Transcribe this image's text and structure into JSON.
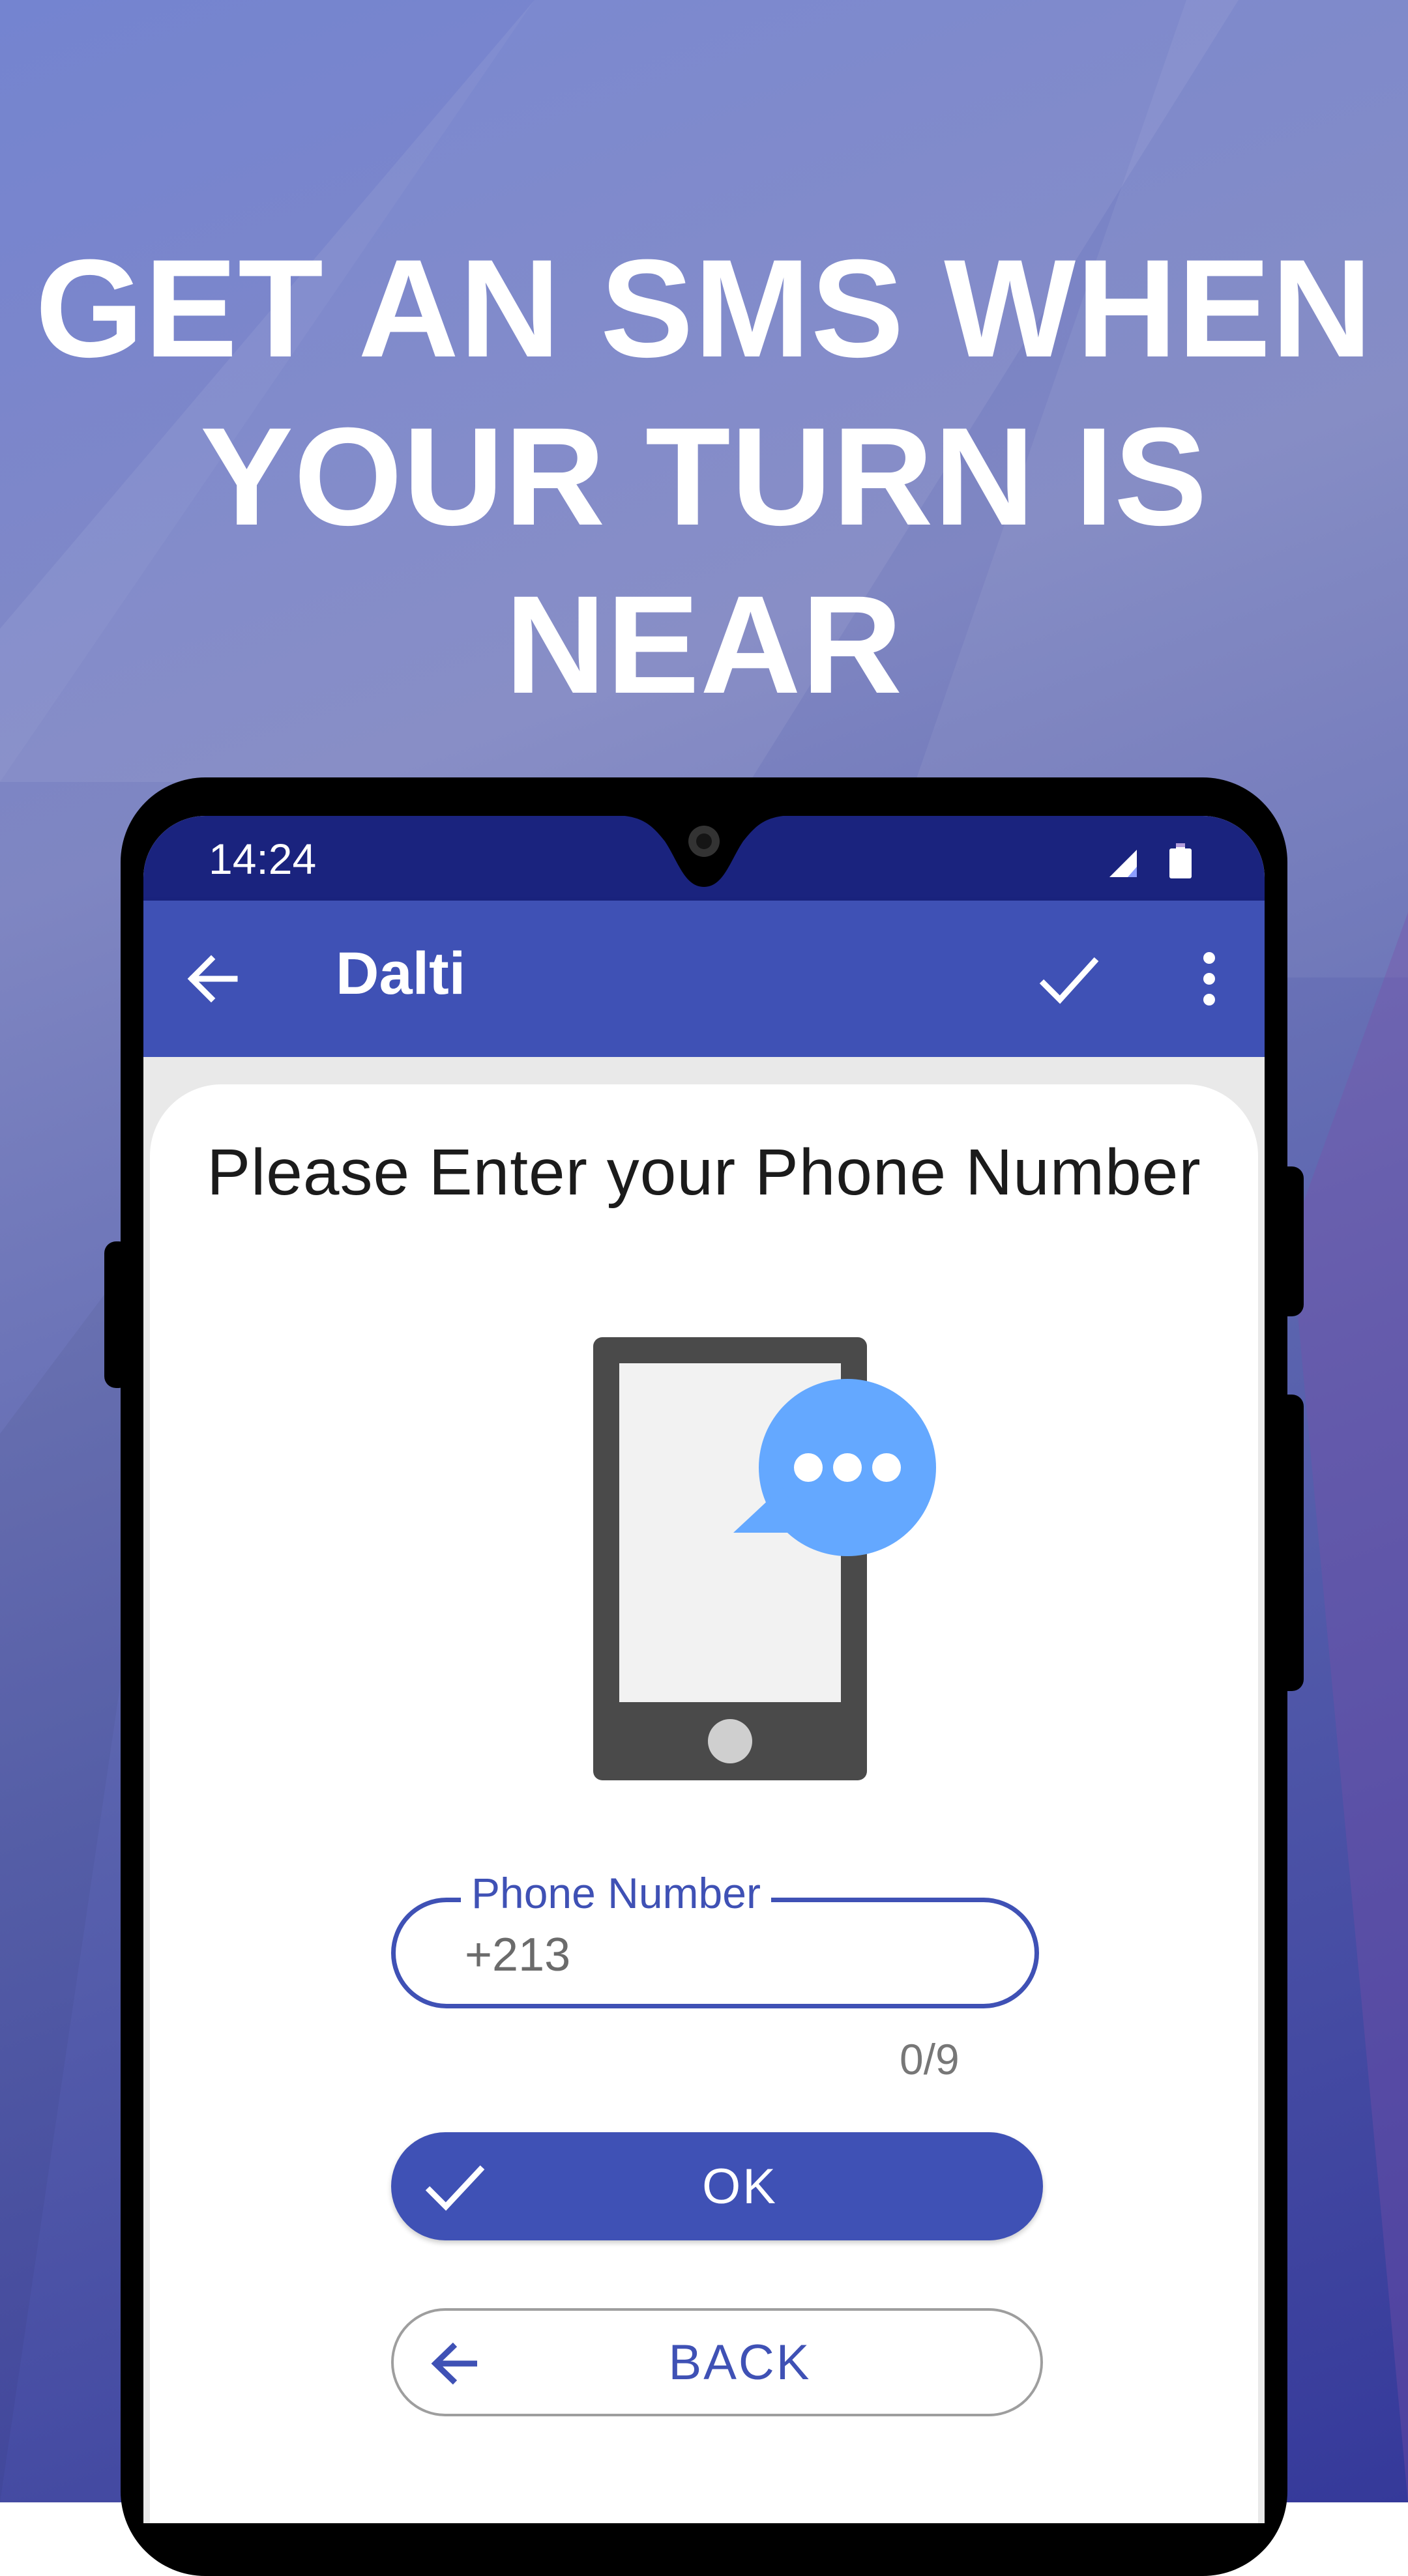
{
  "headline": {
    "line1": "GET AN SMS WHEN",
    "line2": "YOUR TURN IS NEAR"
  },
  "status_bar": {
    "time": "14:24",
    "icons": [
      "signal-icon",
      "battery-icon"
    ]
  },
  "toolbar": {
    "title": "Dalti",
    "icons": [
      "arrow-back-icon",
      "check-icon",
      "more-vert-icon"
    ]
  },
  "content": {
    "title": "Please Enter your Phone Number",
    "illustration": "phone-with-message-bubble"
  },
  "phone_field": {
    "label": "Phone Number",
    "prefix": "+213",
    "value": "",
    "counter": "0/9"
  },
  "buttons": {
    "ok_label": "OK",
    "back_label": "BACK"
  },
  "colors": {
    "primary": "#3f51b5",
    "primary_dark": "#1a237e",
    "bubble": "#64a8ff",
    "device": "#4a4a4a"
  }
}
